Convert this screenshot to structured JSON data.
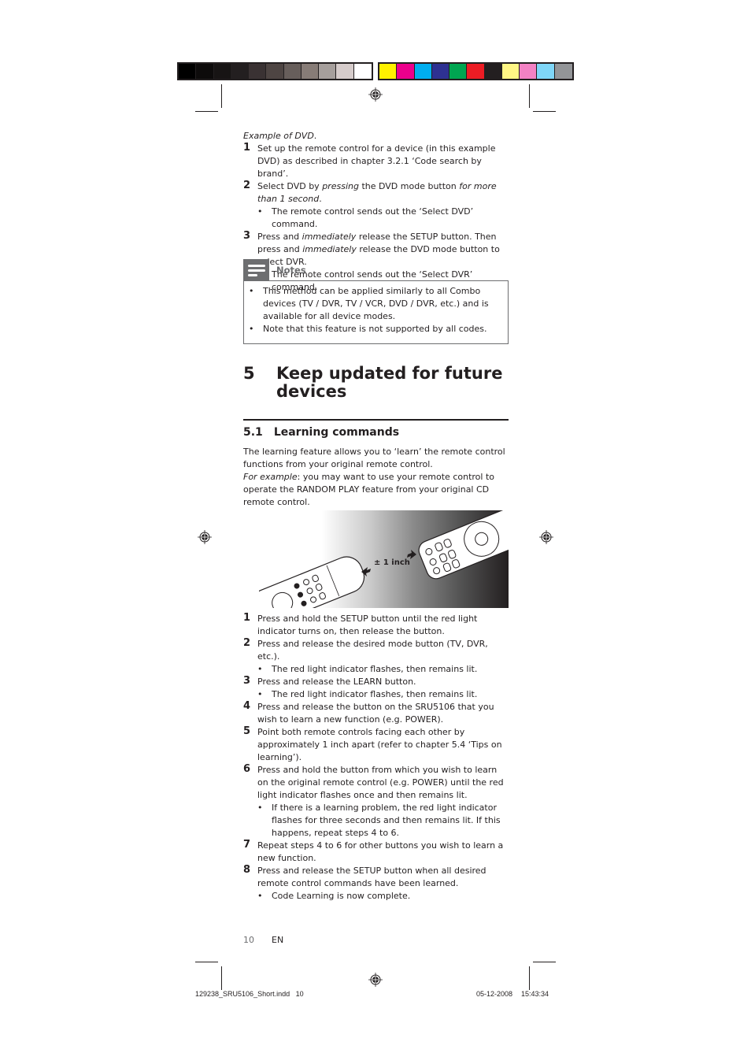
{
  "print_marks": {
    "grayscale_swatches": [
      "#000000",
      "#0d0b0b",
      "#171414",
      "#231f20",
      "#3a3233",
      "#4e4543",
      "#675e5b",
      "#877c77",
      "#a69f9c",
      "#d6cccb",
      "#ffffff"
    ],
    "color_swatches": [
      "#fff200",
      "#ec008c",
      "#00aeef",
      "#2e3192",
      "#00a651",
      "#ed1c24",
      "#231f20",
      "#fff685",
      "#f382c4",
      "#7fd6f7",
      "#939598"
    ]
  },
  "section_dvd": {
    "intro": "Example of DVD",
    "intro_end": ".",
    "steps": [
      {
        "num": "1",
        "text": "Set up the remote control for a device (in this example DVD) as described in chapter 3.2.1 ‘Code search by brand’."
      },
      {
        "num": "2",
        "a": "Select DVD by ",
        "b": "pressing",
        "c": " the DVD mode button ",
        "d": "for more than 1 second",
        "e": "."
      },
      {
        "bullet": "The remote control sends out the ‘Select DVD’ command."
      },
      {
        "num": "3",
        "a": "Press and ",
        "b": "immediately",
        "c": " release the SETUP button. Then press and ",
        "d": "immediately",
        "e": " release the DVD mode button to select DVR."
      },
      {
        "bullet": "The remote control sends out the ‘Select DVR’ command."
      }
    ]
  },
  "notes": {
    "label": "Notes",
    "items": [
      "This method can be applied similarly to all Combo devices (TV / DVR, TV / VCR, DVD / DVR, etc.) and is available for all device modes.",
      "Note that this feature is not supported by all codes."
    ]
  },
  "chapter": {
    "number": "5",
    "title": "Keep updated for future devices"
  },
  "subsection": {
    "number": "5.1",
    "title": "Learning commands"
  },
  "intro": {
    "p1": "The learning feature allows you to ‘learn’ the remote control functions from your original remote control.",
    "p2_label": "For example",
    "p2_text": ": you may want to use your remote control to operate the RANDOM PLAY feature from your original CD remote control."
  },
  "figure": {
    "distance_label": "± 1 inch"
  },
  "learning_steps": [
    {
      "num": "1",
      "text": "Press and hold the SETUP button until the red light indicator turns on, then release the button."
    },
    {
      "num": "2",
      "text": "Press and release the desired mode button (TV, DVR, etc.)."
    },
    {
      "bullet": "The red light indicator flashes, then remains lit."
    },
    {
      "num": "3",
      "text": "Press and release the LEARN button."
    },
    {
      "bullet": "The red light indicator flashes, then remains lit."
    },
    {
      "num": "4",
      "text": "Press and release the button on the SRU5106 that you wish to learn a new function (e.g. POWER)."
    },
    {
      "num": "5",
      "text": "Point both remote controls facing each other by approximately 1 inch apart (refer to chapter 5.4 ‘Tips on learning’)."
    },
    {
      "num": "6",
      "text": "Press and hold the button from which you wish to learn on the original remote control (e.g. POWER) until the red light indicator flashes once and then remains lit."
    },
    {
      "bullet": "If there is a learning problem, the red light indicator flashes for three seconds and then remains lit. If this happens, repeat steps 4 to 6."
    },
    {
      "num": "7",
      "text": "Repeat steps 4 to 6 for other buttons you wish to learn a new function."
    },
    {
      "num": "8",
      "text": "Press and release the SETUP button when all desired remote control commands have been learned."
    },
    {
      "bullet": "Code Learning is now complete."
    }
  ],
  "page_footer": {
    "page_number": "10",
    "language": "EN"
  },
  "slug": {
    "filename": "129238_SRU5106_Short.indd   10",
    "date": "05-12-2008",
    "time": "15:43:34"
  }
}
